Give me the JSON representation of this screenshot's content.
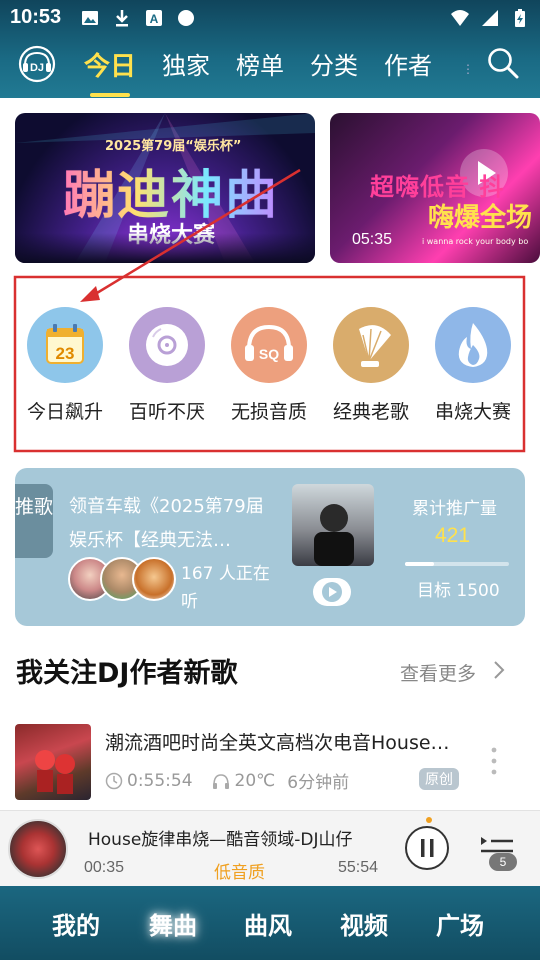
{
  "status_bar": {
    "time": "10:53",
    "notification_icons": [
      "image-icon",
      "download-icon",
      "text-a-icon",
      "circle-icon"
    ],
    "system_icons": [
      "wifi-icon",
      "signal-icon",
      "battery-charging-icon"
    ]
  },
  "header": {
    "logo_text": "DJ",
    "tabs": [
      {
        "label": "今日",
        "active": true
      },
      {
        "label": "独家",
        "active": false
      },
      {
        "label": "榜单",
        "active": false
      },
      {
        "label": "分类",
        "active": false
      },
      {
        "label": "作者",
        "active": false
      }
    ],
    "search_icon": "search-icon"
  },
  "banners": [
    {
      "subtitle": "2025第79届“娱乐杯”",
      "title": "蹦迪神曲",
      "band": "串烧大赛"
    },
    {
      "title": "超嗨低音 抖",
      "title2": "嗨爆全场",
      "duration": "05:35",
      "tagline": "i wanna rock your body bo"
    }
  ],
  "categories": [
    {
      "label": "今日飙升",
      "icon": "calendar-icon",
      "icon_text": "23",
      "color": "#8ec6ea"
    },
    {
      "label": "百听不厌",
      "icon": "disc-icon",
      "color": "#b9a0d6"
    },
    {
      "label": "无损音质",
      "icon": "headphones-sq-icon",
      "icon_text": "SQ",
      "color": "#eda07e"
    },
    {
      "label": "经典老歌",
      "icon": "gramophone-icon",
      "color": "#d9ac6c"
    },
    {
      "label": "串烧大赛",
      "icon": "flame-icon",
      "color": "#8fb7e8"
    }
  ],
  "promo": {
    "tag": "推歌",
    "text": "领音车载《2025第79届娱乐杯【经典无法…",
    "listeners": "167 人正在听",
    "stat_label": "累计推广量",
    "stat_value": "421",
    "target": "目标 1500",
    "progress": 0.28
  },
  "section": {
    "title": "我关注DJ作者新歌",
    "more": "查看更多"
  },
  "song": {
    "title": "潮流酒吧时尚全英文高档次电音House…",
    "duration": "0:55:54",
    "temperature": "20℃",
    "time_ago": "6分钟前",
    "badge": "原创"
  },
  "player": {
    "title": "House旋律串烧—酷音领域-DJ山仔",
    "elapsed": "00:35",
    "quality": "低音质",
    "total": "55:54",
    "queue_count": "5"
  },
  "bottom_nav": [
    {
      "label": "我的",
      "active": false
    },
    {
      "label": "舞曲",
      "active": true
    },
    {
      "label": "曲风",
      "active": false
    },
    {
      "label": "视频",
      "active": false
    },
    {
      "label": "广场",
      "active": false
    }
  ]
}
